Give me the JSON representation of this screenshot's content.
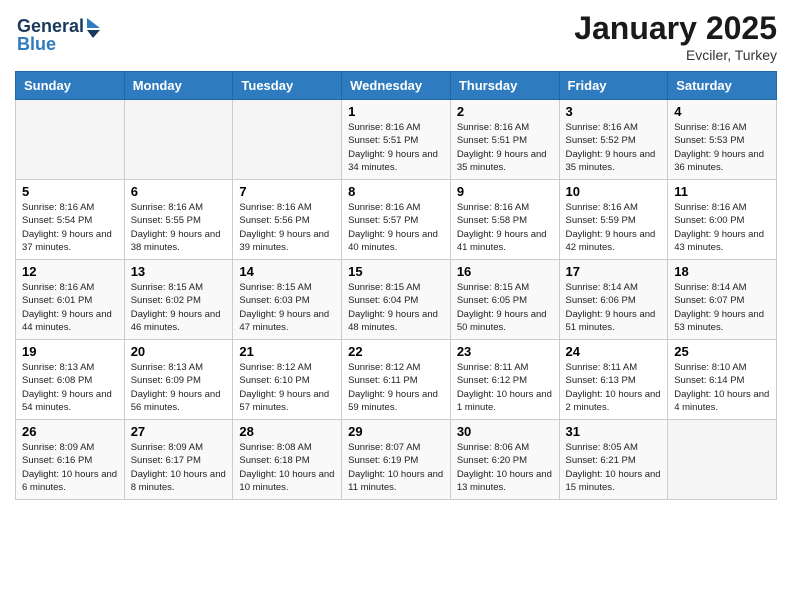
{
  "header": {
    "logo_line1": "General",
    "logo_line2": "Blue",
    "month": "January 2025",
    "location": "Evciler, Turkey"
  },
  "weekdays": [
    "Sunday",
    "Monday",
    "Tuesday",
    "Wednesday",
    "Thursday",
    "Friday",
    "Saturday"
  ],
  "weeks": [
    [
      {
        "day": "",
        "info": ""
      },
      {
        "day": "",
        "info": ""
      },
      {
        "day": "",
        "info": ""
      },
      {
        "day": "1",
        "info": "Sunrise: 8:16 AM\nSunset: 5:51 PM\nDaylight: 9 hours\nand 34 minutes."
      },
      {
        "day": "2",
        "info": "Sunrise: 8:16 AM\nSunset: 5:51 PM\nDaylight: 9 hours\nand 35 minutes."
      },
      {
        "day": "3",
        "info": "Sunrise: 8:16 AM\nSunset: 5:52 PM\nDaylight: 9 hours\nand 35 minutes."
      },
      {
        "day": "4",
        "info": "Sunrise: 8:16 AM\nSunset: 5:53 PM\nDaylight: 9 hours\nand 36 minutes."
      }
    ],
    [
      {
        "day": "5",
        "info": "Sunrise: 8:16 AM\nSunset: 5:54 PM\nDaylight: 9 hours\nand 37 minutes."
      },
      {
        "day": "6",
        "info": "Sunrise: 8:16 AM\nSunset: 5:55 PM\nDaylight: 9 hours\nand 38 minutes."
      },
      {
        "day": "7",
        "info": "Sunrise: 8:16 AM\nSunset: 5:56 PM\nDaylight: 9 hours\nand 39 minutes."
      },
      {
        "day": "8",
        "info": "Sunrise: 8:16 AM\nSunset: 5:57 PM\nDaylight: 9 hours\nand 40 minutes."
      },
      {
        "day": "9",
        "info": "Sunrise: 8:16 AM\nSunset: 5:58 PM\nDaylight: 9 hours\nand 41 minutes."
      },
      {
        "day": "10",
        "info": "Sunrise: 8:16 AM\nSunset: 5:59 PM\nDaylight: 9 hours\nand 42 minutes."
      },
      {
        "day": "11",
        "info": "Sunrise: 8:16 AM\nSunset: 6:00 PM\nDaylight: 9 hours\nand 43 minutes."
      }
    ],
    [
      {
        "day": "12",
        "info": "Sunrise: 8:16 AM\nSunset: 6:01 PM\nDaylight: 9 hours\nand 44 minutes."
      },
      {
        "day": "13",
        "info": "Sunrise: 8:15 AM\nSunset: 6:02 PM\nDaylight: 9 hours\nand 46 minutes."
      },
      {
        "day": "14",
        "info": "Sunrise: 8:15 AM\nSunset: 6:03 PM\nDaylight: 9 hours\nand 47 minutes."
      },
      {
        "day": "15",
        "info": "Sunrise: 8:15 AM\nSunset: 6:04 PM\nDaylight: 9 hours\nand 48 minutes."
      },
      {
        "day": "16",
        "info": "Sunrise: 8:15 AM\nSunset: 6:05 PM\nDaylight: 9 hours\nand 50 minutes."
      },
      {
        "day": "17",
        "info": "Sunrise: 8:14 AM\nSunset: 6:06 PM\nDaylight: 9 hours\nand 51 minutes."
      },
      {
        "day": "18",
        "info": "Sunrise: 8:14 AM\nSunset: 6:07 PM\nDaylight: 9 hours\nand 53 minutes."
      }
    ],
    [
      {
        "day": "19",
        "info": "Sunrise: 8:13 AM\nSunset: 6:08 PM\nDaylight: 9 hours\nand 54 minutes."
      },
      {
        "day": "20",
        "info": "Sunrise: 8:13 AM\nSunset: 6:09 PM\nDaylight: 9 hours\nand 56 minutes."
      },
      {
        "day": "21",
        "info": "Sunrise: 8:12 AM\nSunset: 6:10 PM\nDaylight: 9 hours\nand 57 minutes."
      },
      {
        "day": "22",
        "info": "Sunrise: 8:12 AM\nSunset: 6:11 PM\nDaylight: 9 hours\nand 59 minutes."
      },
      {
        "day": "23",
        "info": "Sunrise: 8:11 AM\nSunset: 6:12 PM\nDaylight: 10 hours\nand 1 minute."
      },
      {
        "day": "24",
        "info": "Sunrise: 8:11 AM\nSunset: 6:13 PM\nDaylight: 10 hours\nand 2 minutes."
      },
      {
        "day": "25",
        "info": "Sunrise: 8:10 AM\nSunset: 6:14 PM\nDaylight: 10 hours\nand 4 minutes."
      }
    ],
    [
      {
        "day": "26",
        "info": "Sunrise: 8:09 AM\nSunset: 6:16 PM\nDaylight: 10 hours\nand 6 minutes."
      },
      {
        "day": "27",
        "info": "Sunrise: 8:09 AM\nSunset: 6:17 PM\nDaylight: 10 hours\nand 8 minutes."
      },
      {
        "day": "28",
        "info": "Sunrise: 8:08 AM\nSunset: 6:18 PM\nDaylight: 10 hours\nand 10 minutes."
      },
      {
        "day": "29",
        "info": "Sunrise: 8:07 AM\nSunset: 6:19 PM\nDaylight: 10 hours\nand 11 minutes."
      },
      {
        "day": "30",
        "info": "Sunrise: 8:06 AM\nSunset: 6:20 PM\nDaylight: 10 hours\nand 13 minutes."
      },
      {
        "day": "31",
        "info": "Sunrise: 8:05 AM\nSunset: 6:21 PM\nDaylight: 10 hours\nand 15 minutes."
      },
      {
        "day": "",
        "info": ""
      }
    ]
  ]
}
